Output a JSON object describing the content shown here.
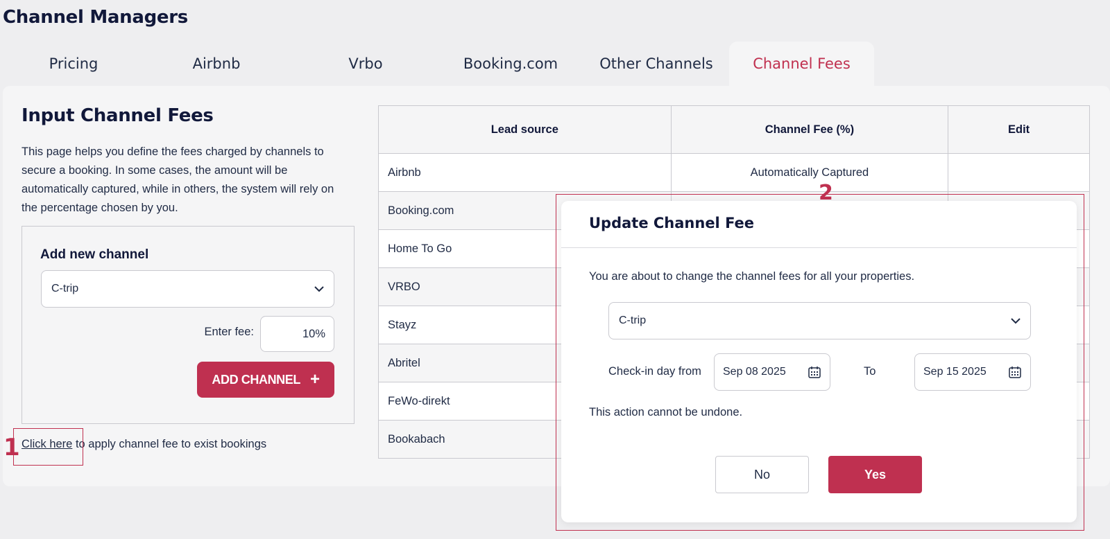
{
  "page_title": "Channel Managers",
  "tabs": [
    {
      "label": "Pricing"
    },
    {
      "label": "Airbnb"
    },
    {
      "label": "Vrbo"
    },
    {
      "label": "Booking.com"
    },
    {
      "label": "Other Channels"
    },
    {
      "label": "Channel Fees",
      "active": true
    }
  ],
  "section": {
    "title": "Input Channel Fees",
    "description": "This page helps you define the fees charged by channels to secure a booking. In some cases, the amount will be automatically captured, while in others, the system will rely on the percentage chosen by you."
  },
  "add_channel": {
    "title": "Add new channel",
    "selected_channel": "C-trip",
    "fee_label": "Enter fee:",
    "fee_value": "10%",
    "button_label": "ADD CHANNEL",
    "button_icon": "plus-icon"
  },
  "apply_line": {
    "link_text": "Click here",
    "rest_text": " to apply channel fee to exist bookings"
  },
  "annotations": [
    "1",
    "2"
  ],
  "table": {
    "headers": [
      "Lead source",
      "Channel Fee (%)",
      "Edit"
    ],
    "rows": [
      {
        "lead_source": "Airbnb",
        "fee": "Automatically Captured"
      },
      {
        "lead_source": "Booking.com",
        "fee": ""
      },
      {
        "lead_source": "Home To Go",
        "fee": ""
      },
      {
        "lead_source": "VRBO",
        "fee": ""
      },
      {
        "lead_source": "Stayz",
        "fee": ""
      },
      {
        "lead_source": "Abritel",
        "fee": ""
      },
      {
        "lead_source": "FeWo-direkt",
        "fee": ""
      },
      {
        "lead_source": "Bookabach",
        "fee": ""
      }
    ]
  },
  "modal": {
    "title": "Update Channel Fee",
    "message": "You are about to change the channel fees for all your properties.",
    "selected_channel": "C-trip",
    "checkin_label": "Check-in day from",
    "date_from": "Sep 08 2025",
    "to_label": "To",
    "date_to": "Sep 15 2025",
    "warning": "This action cannot be undone.",
    "no_label": "No",
    "yes_label": "Yes"
  },
  "colors": {
    "accent": "#bf3050",
    "background": "#eeeef0",
    "panel": "#f5f5f6",
    "text": "#1f2a44"
  }
}
